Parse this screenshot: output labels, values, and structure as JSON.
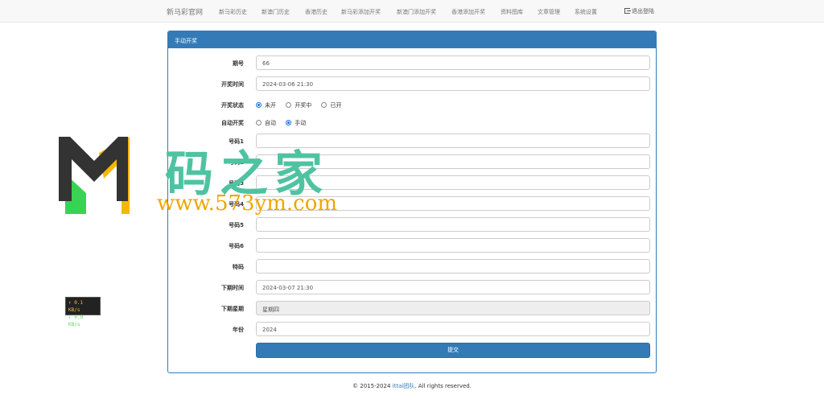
{
  "navbar": {
    "brand": "新马彩官网",
    "items": [
      "新马彩历史",
      "新澳门历史",
      "香港历史",
      "新马彩添加开奖",
      "新澳门添加开奖",
      "香港添加开奖",
      "资料图库",
      "文章管理",
      "系统设置"
    ],
    "logout": "退出登陆"
  },
  "panel": {
    "title": "手动开奖",
    "fields": {
      "period": {
        "label": "期号",
        "value": "66"
      },
      "draw_time": {
        "label": "开奖时间",
        "value": "2024-03-06 21:30"
      },
      "status": {
        "label": "开奖状态",
        "options": [
          "未开",
          "开奖中",
          "已开"
        ],
        "selected": "未开"
      },
      "auto": {
        "label": "自动开奖",
        "options": [
          "自动",
          "手动"
        ],
        "selected": "手动"
      },
      "num1": {
        "label": "号码1",
        "value": ""
      },
      "num2": {
        "label": "号码2",
        "value": ""
      },
      "num3": {
        "label": "号码3",
        "value": ""
      },
      "num4": {
        "label": "号码4",
        "value": ""
      },
      "num5": {
        "label": "号码5",
        "value": ""
      },
      "num6": {
        "label": "号码6",
        "value": ""
      },
      "special": {
        "label": "特码",
        "value": ""
      },
      "next_time": {
        "label": "下期时间",
        "value": "2024-03-07 21:30"
      },
      "next_weekday": {
        "label": "下期星期",
        "value": "星期四"
      },
      "year": {
        "label": "年份",
        "value": "2024"
      }
    },
    "submit": "提交"
  },
  "footer": {
    "prefix": "© 2015-2024 ",
    "link": "ittai团队",
    "suffix": ". All rights reserved."
  },
  "watermark": {
    "title": "码之家",
    "url": "www.573ym.com"
  },
  "netspeed": {
    "up": "↑ 0.1 KB/s",
    "down": "↓ 0.0 KB/s"
  },
  "colors": {
    "primary": "#337ab7",
    "watermark_green": "#4fc3a1",
    "watermark_orange": "#f0a500"
  }
}
